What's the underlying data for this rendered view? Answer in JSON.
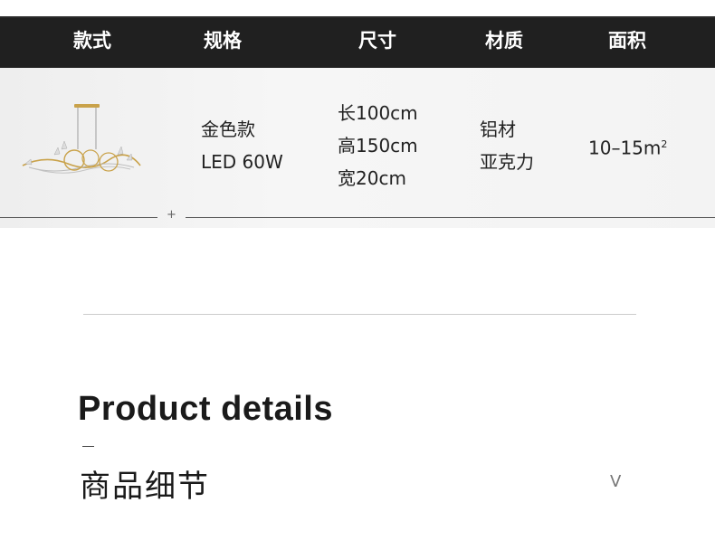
{
  "table": {
    "headers": [
      "款式",
      "规格",
      "尺寸",
      "材质",
      "面积"
    ],
    "spec": [
      "金色款",
      "LED 60W"
    ],
    "size": [
      "长100cm",
      "高150cm",
      "宽20cm"
    ],
    "material": [
      "铝材",
      "亚克力"
    ],
    "area": "10–15m",
    "area_sup": "2",
    "separator": "+"
  },
  "section": {
    "title": "Product details",
    "dash": "—",
    "subtitle": "商品细节",
    "chevron": "V"
  },
  "colors": {
    "header_bg": "#202020",
    "header_text": "#ffffff",
    "row_bg": "#f2f2f2",
    "lamp_gold": "#c9a24a"
  }
}
